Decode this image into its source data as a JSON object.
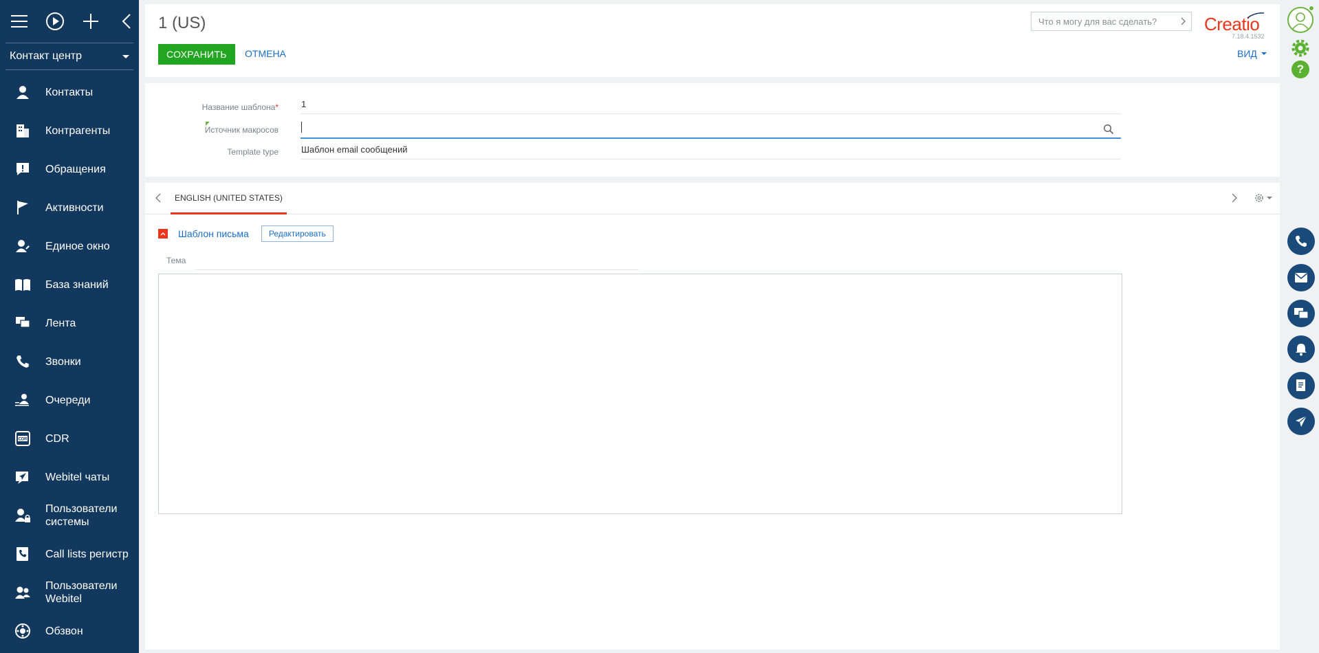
{
  "sidebar": {
    "workspace": "Контакт центр",
    "items": [
      {
        "label": "Контакты",
        "icon": "person-icon"
      },
      {
        "label": "Контрагенты",
        "icon": "building-icon"
      },
      {
        "label": "Обращения",
        "icon": "exclamation-icon"
      },
      {
        "label": "Активности",
        "icon": "flag-icon"
      },
      {
        "label": "Единое окно",
        "icon": "person-edit-icon"
      },
      {
        "label": "База знаний",
        "icon": "book-icon"
      },
      {
        "label": "Лента",
        "icon": "chat-icon"
      },
      {
        "label": "Звонки",
        "icon": "phone-icon"
      },
      {
        "label": "Очереди",
        "icon": "queue-icon"
      },
      {
        "label": "CDR",
        "icon": "cdr-icon"
      },
      {
        "label": "Webitel чаты",
        "icon": "send-icon"
      },
      {
        "label": "Пользователи\nсистемы",
        "icon": "user-lock-icon"
      },
      {
        "label": "Call lists регистр",
        "icon": "phone-list-icon"
      },
      {
        "label": "Пользователи\nWebitel",
        "icon": "users-icon"
      },
      {
        "label": "Обзвон",
        "icon": "dial-icon"
      }
    ]
  },
  "header": {
    "title": "1 (US)",
    "save_label": "СОХРАНИТЬ",
    "cancel_label": "ОТМЕНА",
    "search_placeholder": "Что я могу для вас сделать?",
    "logo": "Creatio",
    "version": "7.18.4.1532",
    "view_label": "ВИД"
  },
  "fields": {
    "name_label": "Название шаблона",
    "name_required": "*",
    "name_value": "1",
    "macro_label": "Источник макросов",
    "macro_value": "",
    "type_label": "Template type",
    "type_value": "Шаблон email сообщений"
  },
  "content": {
    "tab_label": "ENGLISH (UNITED STATES)",
    "group_title": "Шаблон письма",
    "edit_label": "Редактировать",
    "subject_label": "Тема",
    "subject_value": ""
  },
  "colors": {
    "sidebar_bg": "#13385e",
    "accent_red": "#e8371c",
    "save_green": "#22a622",
    "link_blue": "#1a6ec8"
  }
}
